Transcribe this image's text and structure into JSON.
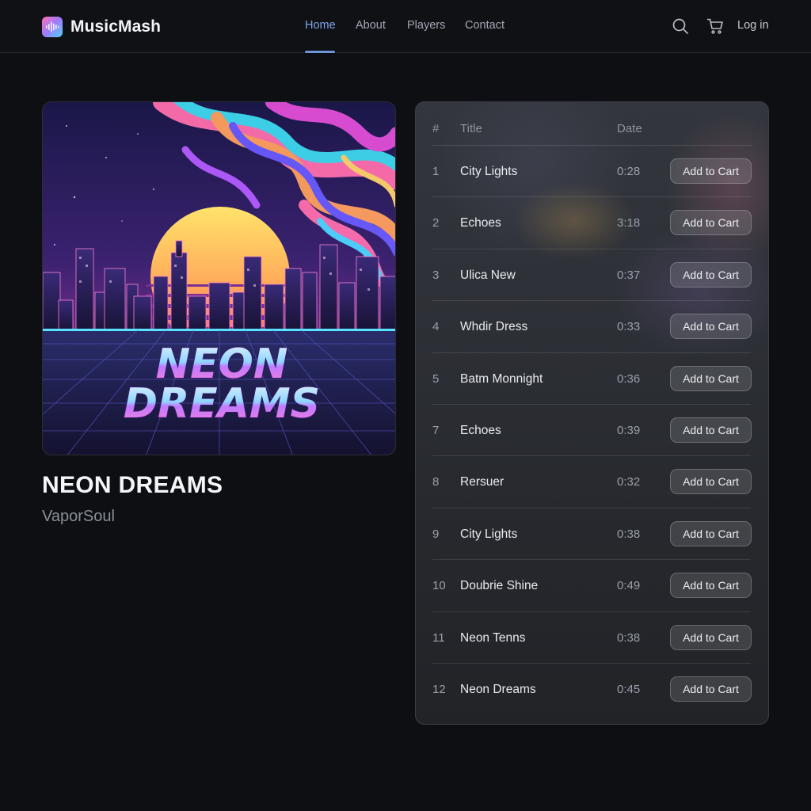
{
  "header": {
    "brand": "MusicMash",
    "nav": [
      {
        "label": "Home",
        "active": true
      },
      {
        "label": "About",
        "active": false
      },
      {
        "label": "Players",
        "active": false
      },
      {
        "label": "Contact",
        "active": false
      }
    ],
    "login_label": "Log in",
    "icons": [
      "search-icon",
      "cart-icon"
    ]
  },
  "album": {
    "cover_text_line1": "NEON",
    "cover_text_line2": "DREAMS",
    "title": "NEON DREAMS",
    "artist": "VaporSoul"
  },
  "tracklist": {
    "columns": {
      "num": "#",
      "title": "Title",
      "date": "Date"
    },
    "button_label": "Add to Cart",
    "tracks": [
      {
        "num": "1",
        "title": "City Lights",
        "date": "0:28"
      },
      {
        "num": "2",
        "title": "Echoes",
        "date": "3:18"
      },
      {
        "num": "3",
        "title": "Ulica New",
        "date": "0:37"
      },
      {
        "num": "4",
        "title": "Whdir Dress",
        "date": "0:33"
      },
      {
        "num": "5",
        "title": "Batm Monnight",
        "date": "0:36"
      },
      {
        "num": "7",
        "title": "Echoes",
        "date": "0:39"
      },
      {
        "num": "8",
        "title": "Rersuer",
        "date": "0:32"
      },
      {
        "num": "9",
        "title": "City Lights",
        "date": "0:38"
      },
      {
        "num": "10",
        "title": "Doubrie Shine",
        "date": "0:49"
      },
      {
        "num": "11",
        "title": "Neon Tenns",
        "date": "0:38"
      },
      {
        "num": "12",
        "title": "Neon Dreams",
        "date": "0:45"
      }
    ]
  },
  "colors": {
    "background": "#0d0f13",
    "accent": "#7fa6e8",
    "panel": "#2d3036"
  }
}
